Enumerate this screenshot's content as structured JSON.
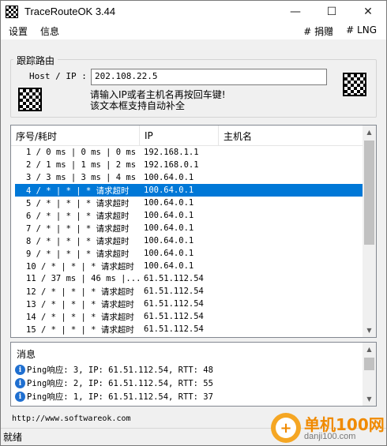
{
  "window": {
    "title": "TraceRouteOK 3.44"
  },
  "menu": {
    "left": [
      "设置",
      "信息"
    ],
    "right": [
      "# 捐赠",
      "# LNG"
    ]
  },
  "route": {
    "group_label": "跟踪路由",
    "host_label": "Host / IP :",
    "host_value": "202.108.22.5",
    "hint_line1": "请输入IP或者主机名再按回车键!",
    "hint_line2": "该文本框支持自动补全"
  },
  "table": {
    "columns": [
      "序号/耗时",
      "IP",
      "主机名"
    ],
    "rows": [
      [
        "1 / 0 ms | 0 ms | 0 ms",
        "192.168.1.1"
      ],
      [
        "2 / 1 ms | 1 ms | 2 ms",
        "192.168.0.1"
      ],
      [
        "3 / 3 ms | 3 ms | 4 ms",
        "100.64.0.1"
      ],
      [
        "4 / * | * | * 请求超时",
        "100.64.0.1"
      ],
      [
        "5 / * | * | * 请求超时",
        "100.64.0.1"
      ],
      [
        "6 / * | * | * 请求超时",
        "100.64.0.1"
      ],
      [
        "7 / * | * | * 请求超时",
        "100.64.0.1"
      ],
      [
        "8 / * | * | * 请求超时",
        "100.64.0.1"
      ],
      [
        "9 / * | * | * 请求超时",
        "100.64.0.1"
      ],
      [
        "10 / * | * | * 请求超时",
        "100.64.0.1"
      ],
      [
        "11 / 37 ms | 46 ms |...",
        "61.51.112.54"
      ],
      [
        "12 / * | * | * 请求超时",
        "61.51.112.54"
      ],
      [
        "13 / * | * | * 请求超时",
        "61.51.112.54"
      ],
      [
        "14 / * | * | * 请求超时",
        "61.51.112.54"
      ],
      [
        "15 / * | * | * 请求超时",
        "61.51.112.54"
      ]
    ]
  },
  "messages": {
    "title": "消息",
    "items": [
      "Ping响应: 3, IP: 61.51.112.54, RTT: 48",
      "Ping响应: 2, IP: 61.51.112.54, RTT: 55",
      "Ping响应: 1, IP: 61.51.112.54, RTT: 37"
    ]
  },
  "footer": {
    "url": "http://www.softwareok.com",
    "status": "就绪"
  },
  "watermark": {
    "line1": "单机100网",
    "line2": "danji100.com"
  },
  "colors": {
    "selection": "#0078d7",
    "watermark": "#f08a00"
  }
}
